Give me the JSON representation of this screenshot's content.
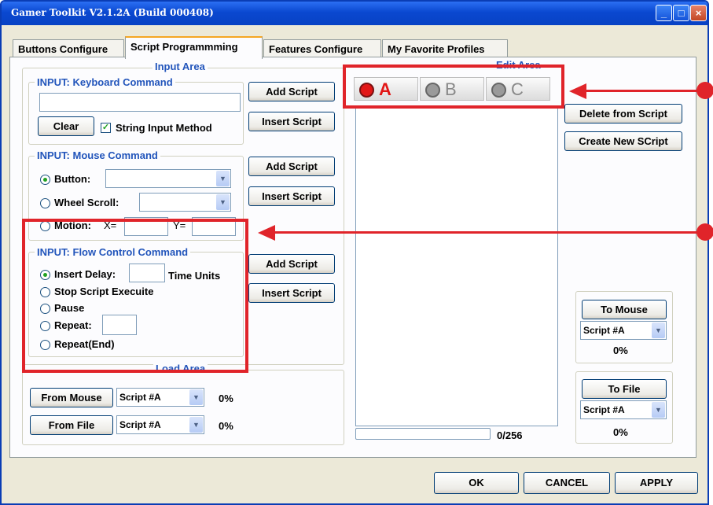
{
  "window": {
    "title": "Gamer Toolkit V2.1.2A (Build 000408)"
  },
  "tabs": [
    "Buttons Configure",
    "Script Programmming",
    "Features Configure",
    "My Favorite Profiles"
  ],
  "input_area": {
    "title": "Input Area",
    "keyboard": {
      "heading": "INPUT: Keyboard Command",
      "value": "",
      "clear": "Clear",
      "string_method": "String Input Method",
      "string_method_checked": true,
      "add": "Add Script",
      "insert": "Insert Script"
    },
    "mouse": {
      "heading": "INPUT: Mouse Command",
      "button_label": "Button:",
      "wheel_label": "Wheel Scroll:",
      "motion_label": "Motion:",
      "x_label": "X=",
      "y_label": "Y=",
      "add": "Add Script",
      "insert": "Insert Script",
      "selected": "Button"
    },
    "flow": {
      "heading": "INPUT: Flow Control Command",
      "insert_delay": "Insert Delay:",
      "time_units": "Time Units",
      "stop": "Stop Script Execuite",
      "pause": "Pause",
      "repeat": "Repeat:",
      "repeat_end": "Repeat(End)",
      "add": "Add Script",
      "insert": "Insert Script",
      "selected": "Insert Delay"
    }
  },
  "load_area": {
    "title": "Load Area",
    "from_mouse": "From Mouse",
    "from_file": "From File",
    "mouse_script": "Script #A",
    "file_script": "Script #A",
    "mouse_pct": "0%",
    "file_pct": "0%"
  },
  "edit_area": {
    "title": "Edit Area",
    "slots": [
      {
        "label": "A",
        "active": true
      },
      {
        "label": "B",
        "active": false
      },
      {
        "label": "C",
        "active": false
      }
    ],
    "delete": "Delete from Script",
    "create": "Create New SCript",
    "counter": "0/256",
    "progress": 0
  },
  "to_mouse": {
    "label": "To Mouse",
    "script": "Script #A",
    "pct": "0%"
  },
  "to_file": {
    "label": "To File",
    "script": "Script #A",
    "pct": "0%"
  },
  "footer": {
    "ok": "OK",
    "cancel": "CANCEL",
    "apply": "APPLY"
  },
  "icons": {
    "minimize": "minimize-icon",
    "maximize": "maximize-icon",
    "close": "close-icon",
    "combo_arrow": "chevron-down-icon"
  },
  "colors": {
    "titlebar": "#0a48d0",
    "group_title": "#2255bb",
    "annotation": "#e0242a",
    "tab_highlight": "#f5a623"
  }
}
